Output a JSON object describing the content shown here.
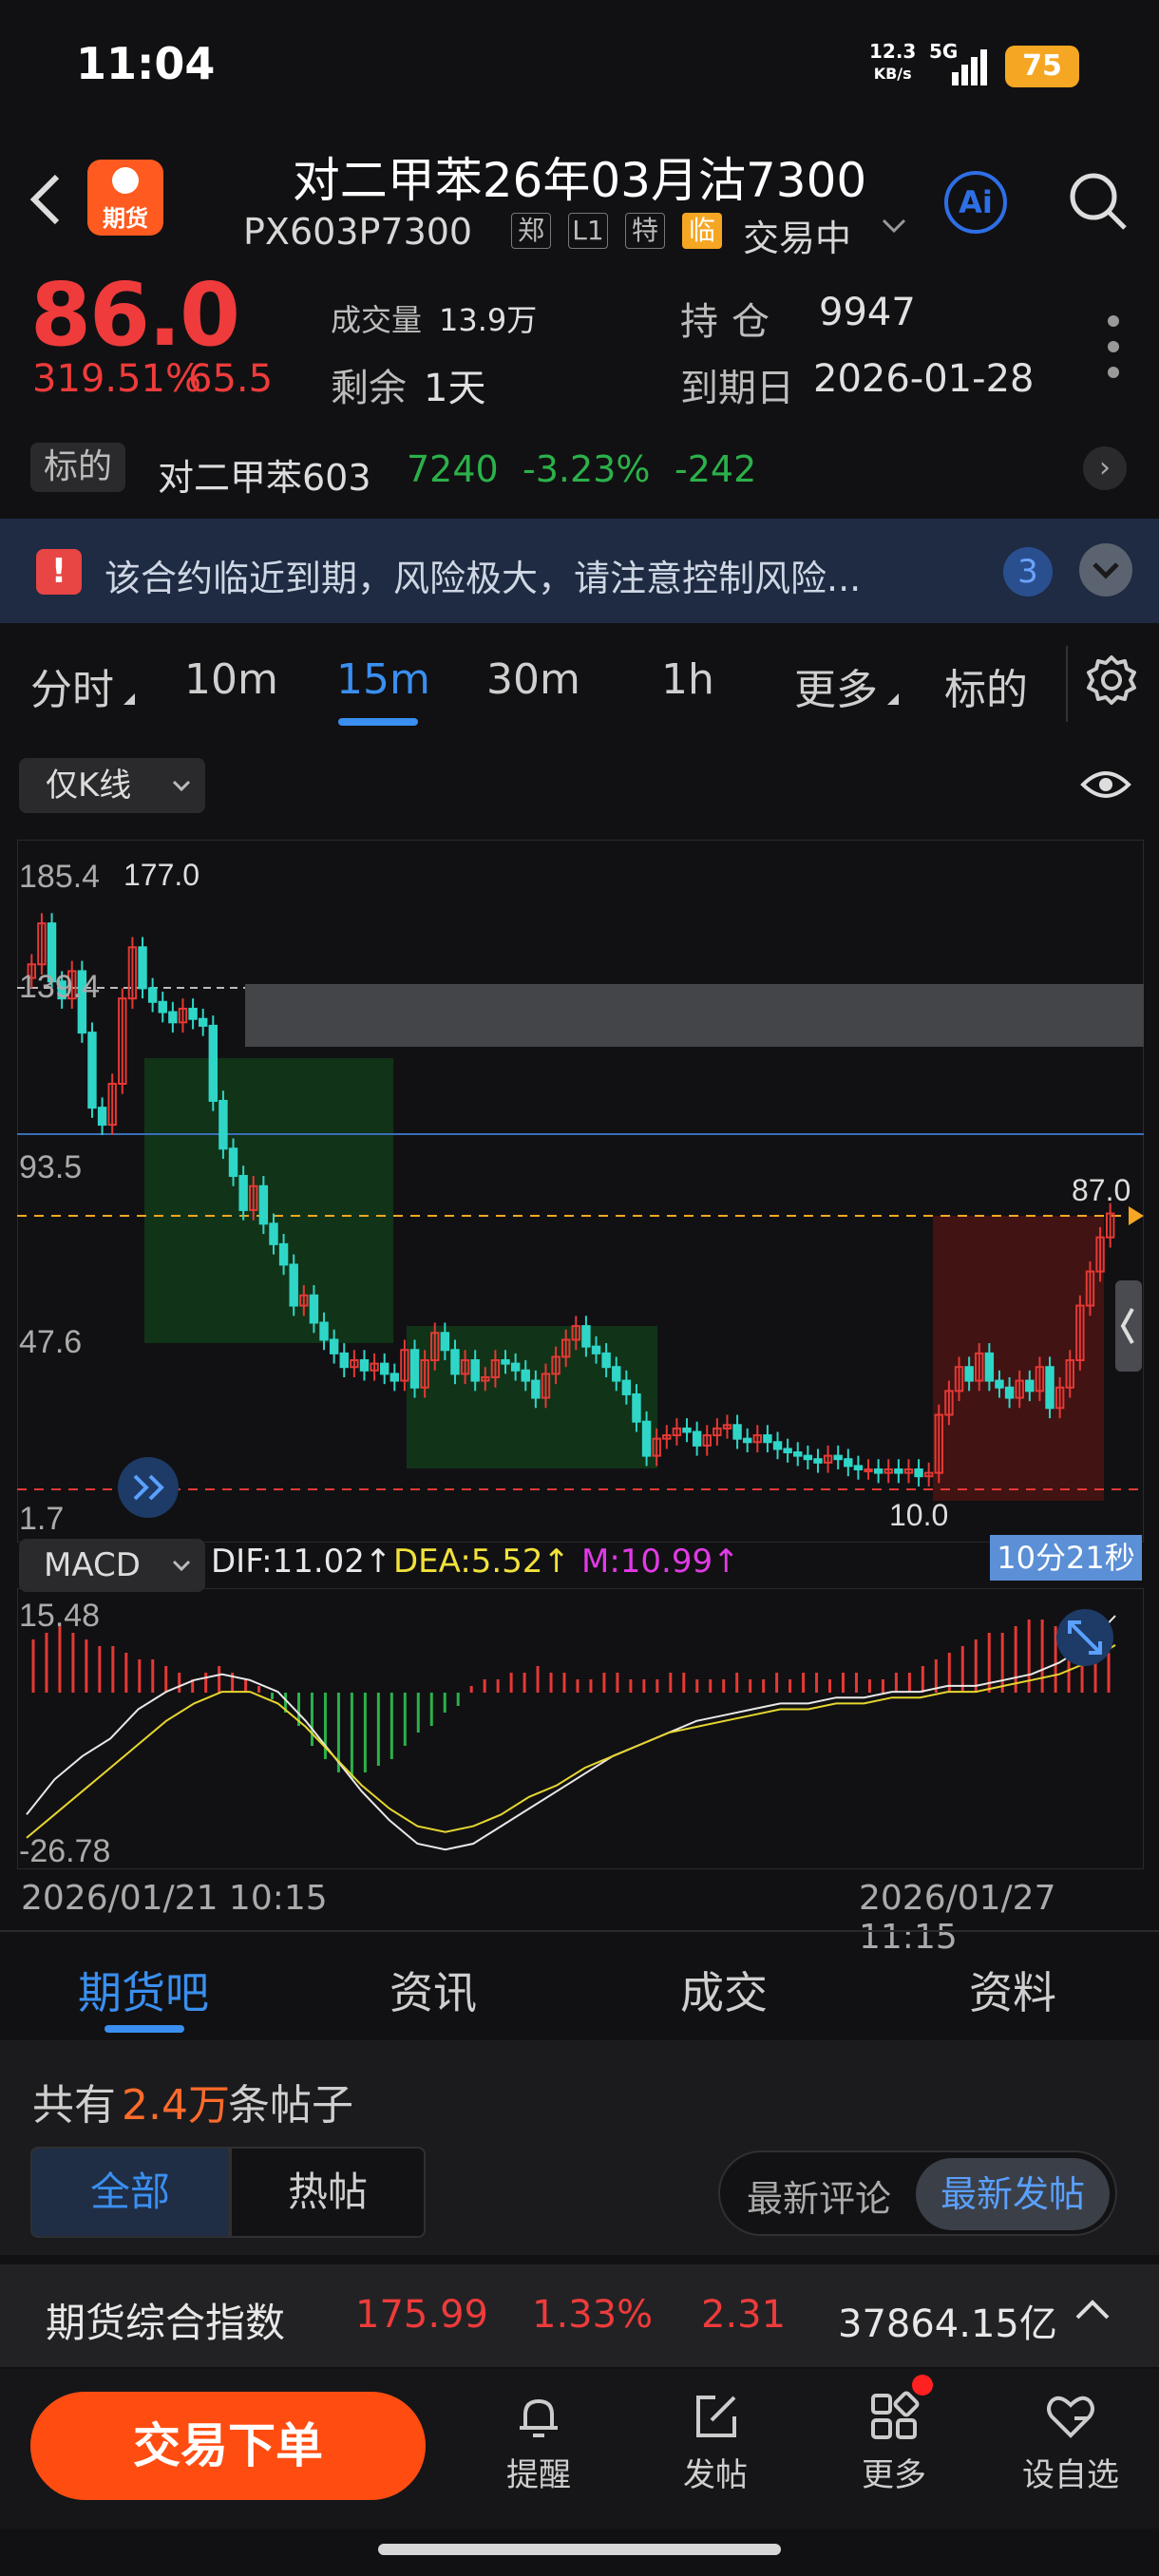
{
  "status_bar": {
    "time": "11:04",
    "net_speed_value": "12.3",
    "net_speed_unit": "KB/s",
    "network": "5G",
    "battery": "75"
  },
  "header": {
    "logo_text": "期货",
    "title": "对二甲苯26年03月沽7300",
    "code": "PX603P7300",
    "tags": [
      "郑",
      "L1",
      "特",
      "临"
    ],
    "status": "交易中",
    "ai_label": "Ai"
  },
  "quote": {
    "last_price": "86.0",
    "change_pct": "319.51%",
    "change_amt": "65.5",
    "volume_label": "成交量",
    "volume_value": "13.9万",
    "remaining_label": "剩余",
    "remaining_value": "1天",
    "oi_label": "持仓",
    "oi_value": "9947",
    "expiry_label": "到期日",
    "expiry_value": "2026-01-28"
  },
  "underlying": {
    "tag": "标的",
    "name": "对二甲苯603",
    "price": "7240",
    "change_pct": "-3.23%",
    "change_amt": "-242"
  },
  "risk_banner": {
    "text": "该合约临近到期，风险极大，请注意控制风险...",
    "count": "3"
  },
  "period_tabs": [
    {
      "label": "分时",
      "active": false
    },
    {
      "label": "10m",
      "active": false
    },
    {
      "label": "15m",
      "active": true
    },
    {
      "label": "30m",
      "active": false
    },
    {
      "label": "1h",
      "active": false
    },
    {
      "label": "更多",
      "active": false
    },
    {
      "label": "标的",
      "active": false
    }
  ],
  "chart": {
    "mode_select": "仅K线",
    "y_labels": [
      "185.4",
      "139.4",
      "93.5",
      "47.6",
      "1.7"
    ],
    "high_marker": "177.0",
    "low_marker": "10.0",
    "last_marker": "87.0",
    "countdown": "10分21秒",
    "x_start": "2026/01/21 10:15",
    "x_end": "2026/01/27 11:15"
  },
  "chart_data": {
    "type": "candlestick",
    "ylim": [
      1.7,
      185.4
    ],
    "y_ticks": [
      185.4,
      139.4,
      93.5,
      47.6,
      1.7
    ],
    "high": 177.0,
    "low": 10.0,
    "last": 87.0,
    "x_range": [
      "2026/01/21 10:15",
      "2026/01/27 11:15"
    ],
    "close": [
      160,
      172,
      155,
      150,
      158,
      140,
      118,
      113,
      125,
      150,
      165,
      153,
      149,
      146,
      143,
      147,
      144,
      142,
      120,
      106,
      98,
      88,
      95,
      84,
      78,
      72,
      60,
      63,
      55,
      50,
      46,
      42,
      44,
      41,
      43,
      40,
      38,
      47,
      36,
      44,
      52,
      47,
      40,
      44,
      38,
      39,
      44,
      43,
      41,
      38,
      33,
      40,
      45,
      50,
      54,
      48,
      46,
      42,
      38,
      34,
      26,
      16,
      21,
      22,
      24,
      23,
      19,
      22,
      24,
      25,
      21,
      20,
      22,
      20,
      18,
      17,
      16,
      15,
      14,
      16,
      15,
      13,
      12,
      12,
      11,
      12,
      11,
      12,
      10,
      11,
      28,
      35,
      42,
      38,
      46,
      38,
      36,
      33,
      38,
      35,
      42,
      30,
      36,
      44,
      60,
      70,
      80,
      87
    ],
    "macd": {
      "dif": 11.02,
      "dea": 5.52,
      "m": 10.99,
      "ylim": [
        -26.78,
        15.48
      ],
      "dif_series": [
        -20,
        -14,
        -10,
        -7,
        -2,
        1,
        3,
        4,
        3,
        1,
        -4,
        -10,
        -16,
        -21,
        -25,
        -26,
        -25,
        -22,
        -19,
        -16,
        -13,
        -10,
        -8,
        -6,
        -4,
        -3,
        -2,
        -1,
        -1,
        0,
        0,
        1,
        1,
        2,
        2,
        3,
        4,
        6,
        9,
        14
      ],
      "dea_series": [
        -24,
        -20,
        -16,
        -12,
        -8,
        -4,
        -1,
        1,
        1,
        -1,
        -5,
        -10,
        -15,
        -19,
        -22,
        -23,
        -22,
        -20,
        -17,
        -15,
        -12,
        -10,
        -8,
        -6,
        -5,
        -4,
        -3,
        -2,
        -2,
        -1,
        -1,
        0,
        0,
        1,
        1,
        2,
        3,
        4,
        6,
        9
      ],
      "hist": [
        8,
        9,
        10,
        9,
        8,
        7,
        7,
        6,
        5,
        5,
        4,
        3,
        2,
        3,
        4,
        3,
        2,
        1,
        -1,
        -3,
        -5,
        -8,
        -10,
        -12,
        -13,
        -12,
        -11,
        -10,
        -8,
        -6,
        -5,
        -3,
        -2,
        1,
        2,
        2,
        3,
        3,
        4,
        3,
        3,
        2,
        2,
        3,
        3,
        2,
        2,
        2,
        3,
        3,
        2,
        2,
        2,
        3,
        2,
        2,
        3,
        2,
        3,
        3,
        2,
        3,
        3,
        2,
        2,
        3,
        3,
        4,
        5,
        6,
        7,
        8,
        9,
        9,
        10,
        11,
        11,
        10,
        9,
        8,
        7,
        6
      ]
    }
  },
  "macd_panel": {
    "select": "MACD",
    "dif_label": "DIF:11.02↑",
    "dea_label": "DEA:5.52↑",
    "m_label": "M:10.99↑",
    "y_top": "15.48",
    "y_bottom": "-26.78"
  },
  "bottom_tabs": [
    {
      "label": "期货吧",
      "active": true
    },
    {
      "label": "资讯",
      "active": false
    },
    {
      "label": "成交",
      "active": false
    },
    {
      "label": "资料",
      "active": false
    }
  ],
  "posts": {
    "prefix": "共有",
    "count": "2.4万",
    "suffix": "条帖子",
    "filter_all": "全部",
    "filter_hot": "热帖",
    "sort_comment": "最新评论",
    "sort_newest": "最新发帖"
  },
  "index_ticker": {
    "name": "期货综合指数",
    "value": "175.99",
    "pct": "1.33%",
    "chg": "2.31",
    "turnover": "37864.15亿"
  },
  "action_bar": {
    "trade_button": "交易下单",
    "nav": [
      {
        "label": "提醒",
        "icon": "bell-icon"
      },
      {
        "label": "发帖",
        "icon": "edit-icon"
      },
      {
        "label": "更多",
        "icon": "grid-icon"
      },
      {
        "label": "设自选",
        "icon": "heart-icon"
      }
    ]
  },
  "colors": {
    "up": "#ef3b3b",
    "down": "#2bb14a",
    "accent": "#3a8ff0",
    "candle_up": "#e53935",
    "candle_down": "#2fd6c8",
    "trade": "#ff4d12"
  }
}
